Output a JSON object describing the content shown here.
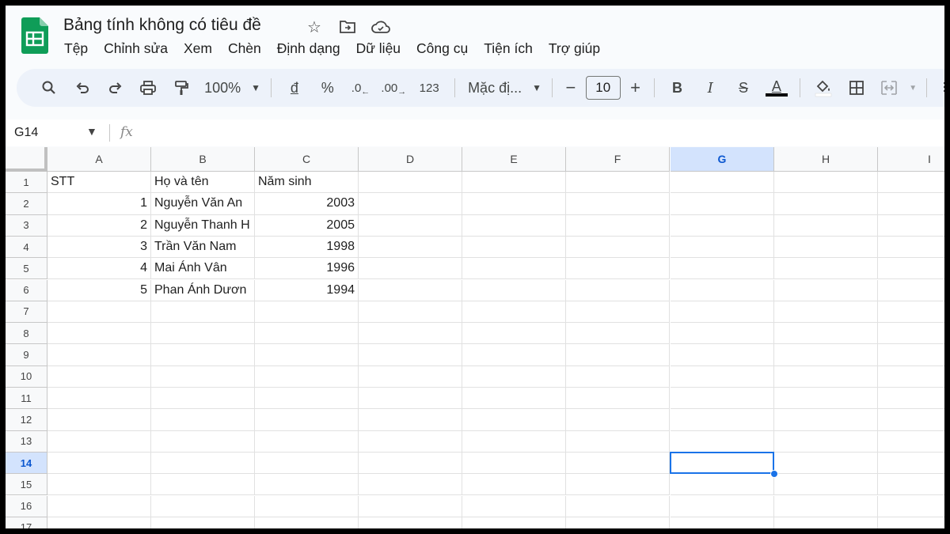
{
  "document": {
    "title": "Bảng tính không có tiêu đề"
  },
  "title_icons": [
    {
      "name": "star-icon",
      "glyph": "☆"
    },
    {
      "name": "move-folder-icon",
      "glyph": "⊞"
    },
    {
      "name": "cloud-saved-icon",
      "glyph": "☁"
    }
  ],
  "menu": [
    "Tệp",
    "Chỉnh sửa",
    "Xem",
    "Chèn",
    "Định dạng",
    "Dữ liệu",
    "Công cụ",
    "Tiện ích",
    "Trợ giúp"
  ],
  "toolbar": {
    "zoom": "100%",
    "currency": "đ",
    "percent": "%",
    "decrease_decimal": ".0",
    "increase_decimal": ".00",
    "number_format": "123",
    "font": "Mặc đị...",
    "font_size": "10",
    "minus": "−",
    "plus": "+",
    "bold": "B",
    "italic": "I",
    "strike": "S",
    "text_color": "A"
  },
  "formula_bar": {
    "cell_ref": "G14",
    "fx": "fx"
  },
  "columns": [
    "A",
    "B",
    "C",
    "D",
    "E",
    "F",
    "G",
    "H",
    "I"
  ],
  "rows": [
    "1",
    "2",
    "3",
    "4",
    "5",
    "6",
    "7",
    "8",
    "9",
    "10",
    "11",
    "12",
    "13",
    "14",
    "15",
    "16",
    "17"
  ],
  "selected_cell": {
    "column": "G",
    "row": "14"
  },
  "table": {
    "headers": [
      "STT",
      "Họ và tên",
      "Năm sinh"
    ],
    "data": [
      [
        "1",
        "Nguyễn Văn An",
        "2003"
      ],
      [
        "2",
        "Nguyễn Thanh H",
        "2005"
      ],
      [
        "3",
        "Trần Văn Nam",
        "1998"
      ],
      [
        "4",
        "Mai Ánh Vân",
        "1996"
      ],
      [
        "5",
        "Phan Ánh Dươn",
        "1994"
      ]
    ]
  },
  "colors": {
    "accent": "#1a73e8",
    "sheets_green": "#0f9d58",
    "selected_header": "#d3e3fd"
  }
}
